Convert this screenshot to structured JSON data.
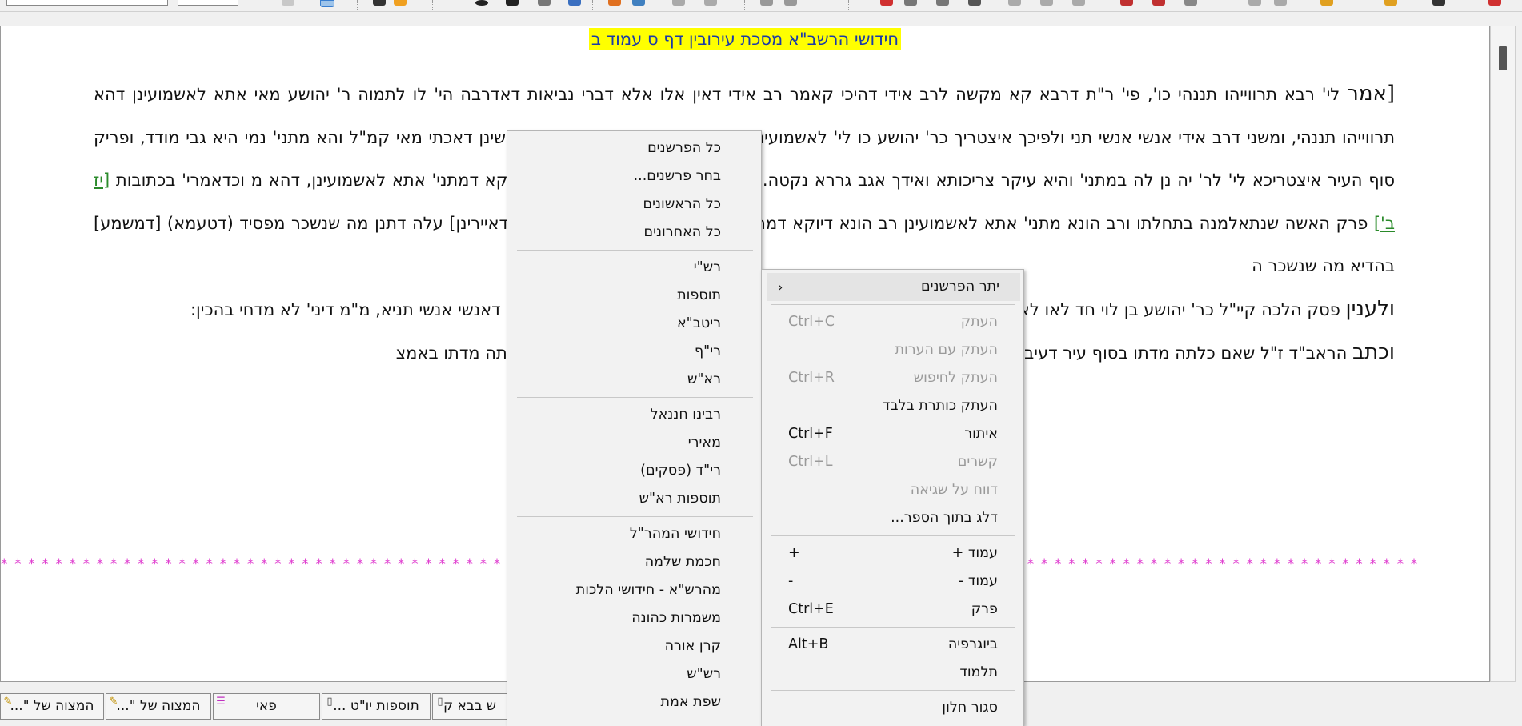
{
  "document": {
    "title": "חידושי הרשב\"א מסכת עירובין דף ס עמוד ב",
    "paragraphs": [
      {
        "lead": "[אמר",
        "text": " לי' רבא תרווייהו תננהי כו', פי' ר\"ת דרבא קא מקשה לרב אידי דהיכי קאמר רב אידי דאין אלו אלא דברי נביאות דאדרבה הי' לו לתמוה ר' יהושע מאי אתא לאשמועינן דהא תרווייהו תננהי, ומשני דרב אידי אנשי אנשי תני ולפיכך איצטריך כר' יהושע כו לי' לאשמועינן דין מודד דלא תני לה במתני', ואקשינן דאכתי מאי קמ\"ל והא מתני' נמי היא גבי מודד, ופריק סוף העיר איצטריכא לי' לר' יה",
        "text_after_ref_before": "נן לה במתני' והיא עיקר צריכותא ואידך אגב גררא נקטה. וקשיא לי לפי' זה] דילמא ריב\"ל דיוקא דמתני' אתא לאשמועינן, דהא מ",
        "ref_gap": "וכדאמרי' בכתובות",
        "ref": "[יז ב']",
        "text_after_ref": "פרק האשה שנתאלמנה בתחלתו ורב הונא מתני' אתא לאשמועינן רב הונא דיוקא דמתני' קמ\"ל, ולכו",
        "text_tail": "יא מתני' (דאמרי') [דאיירינן] עלה דתנן מה שנשכר מפסיד (דטעמא) [דמשמע] בהדיא מה שנשכר ה"
      },
      {
        "lead": "ולענין",
        "text": " פסק הלכה קיי\"ל כר' יהושע בן לוי חד",
        "text_tail": "לאו לאיפלוגי עליה קאמר אלא דמתמה אדיני' מנא לי', ואע\"ג דדחי למתני' ואמר דאנשי אנשי תניא,",
        "text_end": "מ\"מ דיני' לא מדחי בהכין:"
      },
      {
        "lead": "וכתב",
        "text": " הראב\"ד ז\"ל שאם כלתה מדתו בסוף",
        "text_tail": "עיר דעיבור להקל על התחומין אמרו ולא להחמיר,",
        "text_end": "שאם אי אתה אומר כן אפילו כלתה מדתו באמצ"
      }
    ],
    "divider": "* * * * * * * * * * * * * * * * * * * * * * * * * * * * * * * * * * * * * * * * * * * * * * * * * * * * * * * * * * * * * * * * * * * * * * * * * * * * * * * * * * * * * * * * * * * * * * * * * * * * * * * *"
  },
  "menu_left": {
    "items": [
      {
        "label": "כל הפרשנים"
      },
      {
        "label": "בחר פרשנים..."
      },
      {
        "label": "כל הראשונים"
      },
      {
        "label": "כל האחרונים"
      },
      {
        "sep": true
      },
      {
        "label": "רש\"י"
      },
      {
        "label": "תוספות"
      },
      {
        "label": "ריטב\"א"
      },
      {
        "label": "רי\"ף"
      },
      {
        "label": "רא\"ש"
      },
      {
        "sep": true
      },
      {
        "label": "רבינו חננאל"
      },
      {
        "label": "מאירי"
      },
      {
        "label": "רי\"ד (פסקים)"
      },
      {
        "label": "תוספות רא\"ש"
      },
      {
        "sep": true
      },
      {
        "label": "חידושי המהר\"ל"
      },
      {
        "label": "חכמת שלמה"
      },
      {
        "label": "מהרש\"א - חידושי הלכות"
      },
      {
        "label": "משמרות כהונה"
      },
      {
        "label": "קרן אורה"
      },
      {
        "label": "רש\"ש"
      },
      {
        "label": "שפת אמת"
      }
    ]
  },
  "menu_right": {
    "items": [
      {
        "label": "יתר הפרשנים",
        "submenu": true,
        "highlight": true
      },
      {
        "sep": true
      },
      {
        "label": "העתק",
        "shortcut": "Ctrl+C",
        "disabled": true
      },
      {
        "label": "העתק עם הערות",
        "disabled": true
      },
      {
        "label": "העתק לחיפוש",
        "shortcut": "Ctrl+R",
        "disabled": true
      },
      {
        "label": "העתק כותרת בלבד"
      },
      {
        "label": "איתור",
        "shortcut": "Ctrl+F"
      },
      {
        "label": "קשרים",
        "shortcut": "Ctrl+L",
        "disabled": true
      },
      {
        "label": "דווח על שגיאה",
        "disabled": true
      },
      {
        "label": "דלג בתוך הספר..."
      },
      {
        "sep": true
      },
      {
        "label": "עמוד +",
        "shortcut": "+"
      },
      {
        "label": "עמוד -",
        "shortcut": "-"
      },
      {
        "label": "פרק",
        "shortcut": "Ctrl+E"
      },
      {
        "sep": true
      },
      {
        "label": "ביוגרפיה",
        "shortcut": "Alt+B"
      },
      {
        "label": "תלמוד"
      },
      {
        "sep": true
      },
      {
        "label": "סגור חלון"
      }
    ]
  },
  "tabs": [
    {
      "label": "המצוה של \"...",
      "icon": "scroll-icon"
    },
    {
      "label": "המצוה של \"...",
      "icon": "scroll-icon"
    },
    {
      "label": "פאי",
      "icon": "list-icon"
    },
    {
      "label": "תוספות יו\"ט ...",
      "icon": "page-icon"
    },
    {
      "label": "ש בבא ק",
      "icon": "page-icon"
    }
  ]
}
